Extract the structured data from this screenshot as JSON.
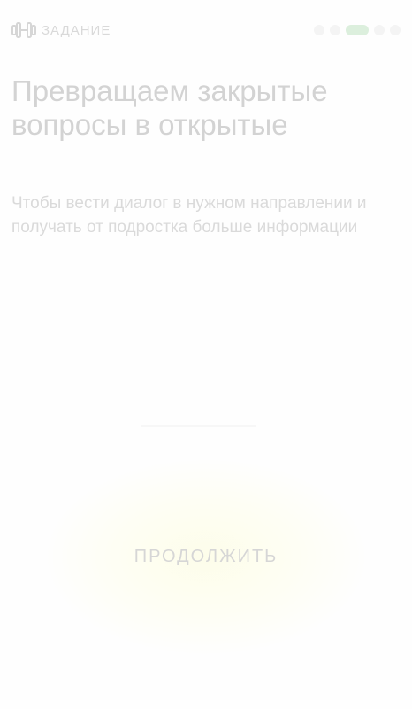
{
  "header": {
    "icon": "dumbbell-icon",
    "label": "ЗАДАНИЕ"
  },
  "progress": {
    "total_steps": 5,
    "current_step": 3
  },
  "main": {
    "title": "Превращаем закрытые вопросы в открытые",
    "subtitle": "Чтобы вести диалог в нужном направлении и получать от подростка больше информации"
  },
  "footer": {
    "continue_label": "ПРОДОЛЖИТЬ"
  },
  "colors": {
    "active_progress": "#dcefdd",
    "glow": "#fdfdea"
  }
}
